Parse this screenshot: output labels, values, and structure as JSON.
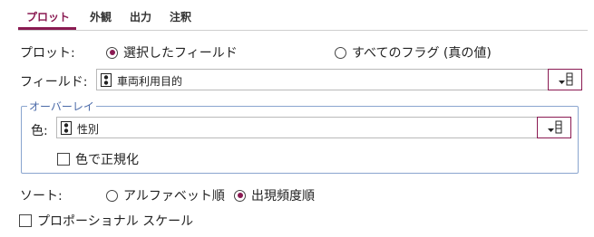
{
  "tabs": [
    {
      "label": "プロット",
      "active": true
    },
    {
      "label": "外観",
      "active": false
    },
    {
      "label": "出力",
      "active": false
    },
    {
      "label": "注釈",
      "active": false
    }
  ],
  "plot": {
    "label": "プロット:",
    "option_selected_fields": "選択したフィールド",
    "option_all_flags": "すべてのフラグ (真の値)",
    "selected": "選択したフィールド"
  },
  "field": {
    "label": "フィールド:",
    "value": "車両利用目的",
    "icon": "nominal-field-icon"
  },
  "overlay": {
    "legend": "オーバーレイ",
    "color_label": "色:",
    "color_value": "性別",
    "icon": "nominal-field-icon",
    "normalize_label": "色で正規化",
    "normalize_checked": false
  },
  "sort": {
    "label": "ソート:",
    "option_alpha": "アルファベット順",
    "option_freq": "出現頻度順",
    "selected": "出現頻度順"
  },
  "proportional_scale": {
    "label": "プロポーショナル スケール",
    "checked": false
  },
  "colors": {
    "accent": "#8a1a52",
    "groupbox_border": "#8aa5cf",
    "groupbox_text": "#4b6aa8"
  }
}
